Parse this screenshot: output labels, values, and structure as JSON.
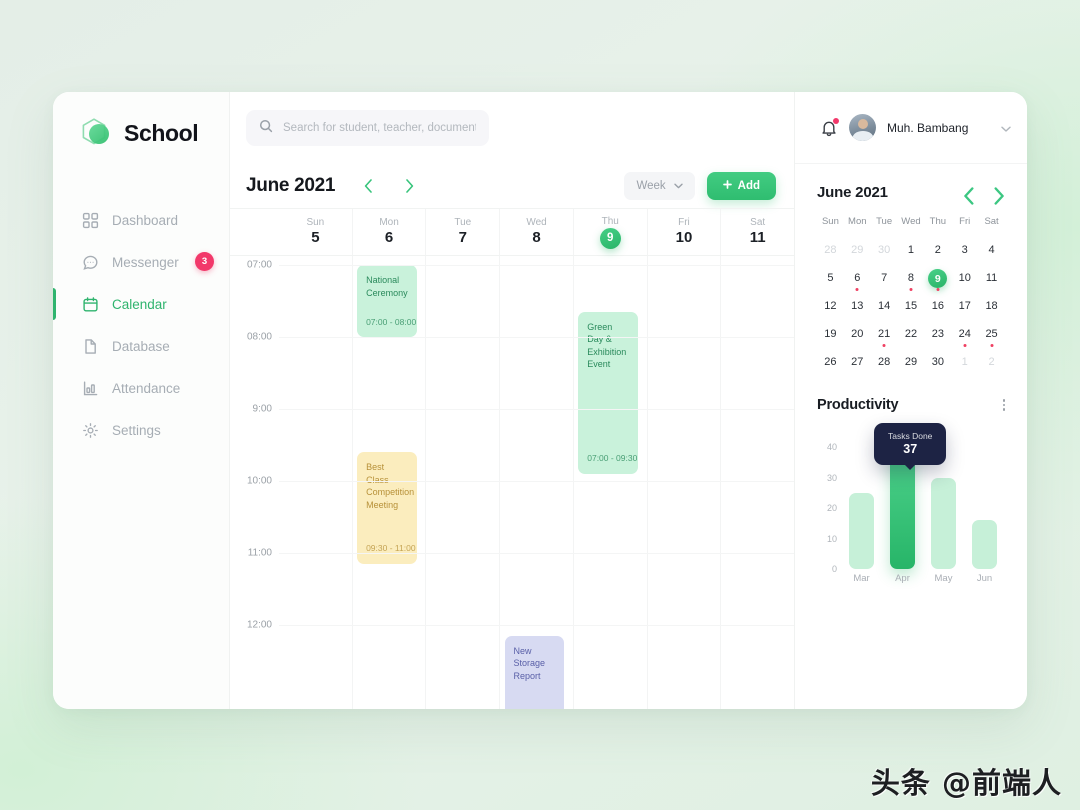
{
  "brand": {
    "name": "School",
    "logo_icon": "hexagon-leaf-logo"
  },
  "sidebar": {
    "items": [
      {
        "label": "Dashboard",
        "icon": "grid-icon",
        "active": false,
        "badge": null
      },
      {
        "label": "Messenger",
        "icon": "chat-bubble-icon",
        "active": false,
        "badge": "3"
      },
      {
        "label": "Calendar",
        "icon": "calendar-icon",
        "active": true,
        "badge": null
      },
      {
        "label": "Database",
        "icon": "document-icon",
        "active": false,
        "badge": null
      },
      {
        "label": "Attendance",
        "icon": "bar-chart-icon",
        "active": false,
        "badge": null
      },
      {
        "label": "Settings",
        "icon": "gear-icon",
        "active": false,
        "badge": null
      }
    ]
  },
  "search": {
    "placeholder": "Search for student, teacher, document...",
    "value": "",
    "icon": "search-icon"
  },
  "calendar_toolbar": {
    "title": "June 2021",
    "prev_icon": "chevron-left-icon",
    "next_icon": "chevron-right-icon",
    "view_label": "Week",
    "view_caret_icon": "chevron-down-icon",
    "add_label": "Add",
    "add_icon": "plus-icon"
  },
  "week": {
    "days": [
      {
        "dow": "Sun",
        "num": "5",
        "today": false
      },
      {
        "dow": "Mon",
        "num": "6",
        "today": false
      },
      {
        "dow": "Tue",
        "num": "7",
        "today": false
      },
      {
        "dow": "Wed",
        "num": "8",
        "today": false
      },
      {
        "dow": "Thu",
        "num": "9",
        "today": true
      },
      {
        "dow": "Fri",
        "num": "10",
        "today": false
      },
      {
        "dow": "Sat",
        "num": "11",
        "today": false
      }
    ],
    "hours": [
      "07:00",
      "08:00",
      "9:00",
      "10:00",
      "11:00",
      "12:00"
    ],
    "events": [
      {
        "title": "National Ceremony",
        "time": "07:00 - 08:00",
        "color": "green",
        "day": 1,
        "start_hour": 7.0,
        "end_hour": 8.0
      },
      {
        "title": "Green Day & Exhibition Event",
        "time": "07:00 - 09:30",
        "color": "green",
        "day": 4,
        "start_hour": 7.65,
        "end_hour": 9.9
      },
      {
        "title": "Best Class Competition Meeting",
        "time": "09:30 - 11:00",
        "color": "yellow",
        "day": 1,
        "start_hour": 9.6,
        "end_hour": 11.15
      },
      {
        "title": "New Storage Report",
        "time": "",
        "color": "blue",
        "day": 3,
        "start_hour": 12.15,
        "end_hour": 13.3
      }
    ]
  },
  "profile": {
    "name": "Muh. Bambang",
    "bell_icon": "bell-icon",
    "has_notification": true,
    "avatar_icon": "user-avatar",
    "caret_icon": "chevron-down-icon"
  },
  "mini_calendar": {
    "title": "June 2021",
    "prev_icon": "chevron-left-icon",
    "next_icon": "chevron-right-icon",
    "dow": [
      "Sun",
      "Mon",
      "Tue",
      "Wed",
      "Thu",
      "Fri",
      "Sat"
    ],
    "weeks": [
      [
        {
          "num": "28",
          "muted": true,
          "dot": false,
          "selected": false
        },
        {
          "num": "29",
          "muted": true,
          "dot": false,
          "selected": false
        },
        {
          "num": "30",
          "muted": true,
          "dot": false,
          "selected": false
        },
        {
          "num": "1",
          "muted": false,
          "dot": false,
          "selected": false
        },
        {
          "num": "2",
          "muted": false,
          "dot": false,
          "selected": false
        },
        {
          "num": "3",
          "muted": false,
          "dot": false,
          "selected": false
        },
        {
          "num": "4",
          "muted": false,
          "dot": false,
          "selected": false
        }
      ],
      [
        {
          "num": "5",
          "muted": false,
          "dot": false,
          "selected": false
        },
        {
          "num": "6",
          "muted": false,
          "dot": true,
          "selected": false
        },
        {
          "num": "7",
          "muted": false,
          "dot": false,
          "selected": false
        },
        {
          "num": "8",
          "muted": false,
          "dot": true,
          "selected": false
        },
        {
          "num": "9",
          "muted": false,
          "dot": true,
          "selected": true
        },
        {
          "num": "10",
          "muted": false,
          "dot": false,
          "selected": false
        },
        {
          "num": "11",
          "muted": false,
          "dot": false,
          "selected": false
        }
      ],
      [
        {
          "num": "12",
          "muted": false,
          "dot": false,
          "selected": false
        },
        {
          "num": "13",
          "muted": false,
          "dot": false,
          "selected": false
        },
        {
          "num": "14",
          "muted": false,
          "dot": false,
          "selected": false
        },
        {
          "num": "15",
          "muted": false,
          "dot": false,
          "selected": false
        },
        {
          "num": "16",
          "muted": false,
          "dot": false,
          "selected": false
        },
        {
          "num": "17",
          "muted": false,
          "dot": false,
          "selected": false
        },
        {
          "num": "18",
          "muted": false,
          "dot": false,
          "selected": false
        }
      ],
      [
        {
          "num": "19",
          "muted": false,
          "dot": false,
          "selected": false
        },
        {
          "num": "20",
          "muted": false,
          "dot": false,
          "selected": false
        },
        {
          "num": "21",
          "muted": false,
          "dot": true,
          "selected": false
        },
        {
          "num": "22",
          "muted": false,
          "dot": false,
          "selected": false
        },
        {
          "num": "23",
          "muted": false,
          "dot": false,
          "selected": false
        },
        {
          "num": "24",
          "muted": false,
          "dot": true,
          "selected": false
        },
        {
          "num": "25",
          "muted": false,
          "dot": true,
          "selected": false
        }
      ],
      [
        {
          "num": "26",
          "muted": false,
          "dot": false,
          "selected": false
        },
        {
          "num": "27",
          "muted": false,
          "dot": false,
          "selected": false
        },
        {
          "num": "28",
          "muted": false,
          "dot": false,
          "selected": false
        },
        {
          "num": "29",
          "muted": false,
          "dot": false,
          "selected": false
        },
        {
          "num": "30",
          "muted": false,
          "dot": false,
          "selected": false
        },
        {
          "num": "1",
          "muted": true,
          "dot": false,
          "selected": false
        },
        {
          "num": "2",
          "muted": true,
          "dot": false,
          "selected": false
        }
      ]
    ]
  },
  "productivity": {
    "title": "Productivity",
    "menu_icon": "kebab-menu-icon",
    "tooltip": {
      "label": "Tasks Done",
      "value": "37",
      "on_category": "Apr"
    }
  },
  "chart_data": {
    "type": "bar",
    "title": "Productivity",
    "categories": [
      "Mar",
      "Apr",
      "May",
      "Jun"
    ],
    "values": [
      25,
      40,
      30,
      16
    ],
    "highlighted_index": 1,
    "yticks": [
      0,
      10,
      20,
      30,
      40
    ],
    "ylim": [
      0,
      40
    ],
    "xlabel": "",
    "ylabel": "",
    "grid": false,
    "legend": "none",
    "annotation": {
      "label": "Tasks Done",
      "value": 37,
      "at": "Apr"
    },
    "colors": {
      "bar": "#c6f0d8",
      "highlight": "#2fc177"
    }
  },
  "colors": {
    "accent": "#2fb46e",
    "badge": "#f2386a",
    "event_green_bg": "#c9f2db",
    "event_green_text": "#2a8a5c",
    "event_yellow_bg": "#fbedbe",
    "event_yellow_text": "#b79139",
    "event_blue_bg": "#d7daf2",
    "event_blue_text": "#5a60a8",
    "tooltip_bg": "#1d2344"
  },
  "watermark": {
    "text": "头条 @前端人"
  }
}
